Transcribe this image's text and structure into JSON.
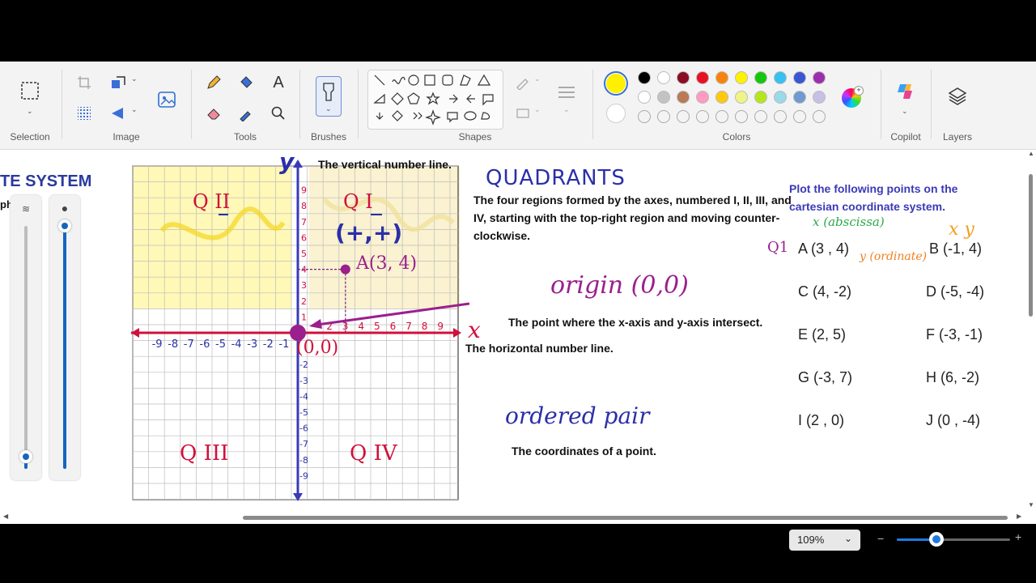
{
  "ribbon": {
    "groups": {
      "selection": "Selection",
      "image": "Image",
      "tools": "Tools",
      "brushes": "Brushes",
      "shapes": "Shapes",
      "colors": "Colors",
      "copilot": "Copilot",
      "layers": "Layers"
    },
    "tools_text_icon": "A",
    "colors": {
      "primary": "#ffef00",
      "secondary": "#ffffff",
      "palette_row1": [
        "#000000",
        "#ffffff",
        "#8b0d24",
        "#e81123",
        "#f7830d",
        "#fff100",
        "#16c60c",
        "#35c1f1",
        "#3a56d4",
        "#9c2fae"
      ],
      "palette_row2": [
        "#ffffff",
        "#c3c3c3",
        "#b97a57",
        "#ff9ac1",
        "#ffc90e",
        "#eff486",
        "#b5e61d",
        "#99d9ea",
        "#709ad1",
        "#c8bfe7"
      ]
    }
  },
  "left_panel": {
    "title_fragment": "TE SYSTEM",
    "label_fragment": "ph",
    "slider1_value_pct": 5,
    "slider2_value_pct": 100
  },
  "canvas": {
    "axis_y_label": "y",
    "axis_x_label": "x",
    "vertical_note": "The vertical number line.",
    "quadrant_labels": {
      "q1": "Q I",
      "q2": "Q II",
      "q3": "Q III",
      "q4": "Q IV"
    },
    "q1_sign": "(+,+)",
    "point_a": "A(3, 4)",
    "origin_label_graph": "(0,0)",
    "quadrants_heading": "QUADRANTS",
    "quadrants_def": [
      "The four regions formed by the axes, numbered I, II, III, and",
      "IV, starting with the top-right region and moving counter-",
      "clockwise."
    ],
    "origin_heading": "origin (0,0)",
    "origin_def": "The point where the x-axis and y-axis intersect.",
    "horizontal_note": "The horizontal number line.",
    "ordered_pair_heading": "ordered pair",
    "ordered_pair_def": "The coordinates of a point.",
    "x_ticks_neg": [
      "-9",
      "-8",
      "-7",
      "-6",
      "-5",
      "-4",
      "-3",
      "-2",
      "-1"
    ],
    "x_ticks_pos": [
      "2",
      "3",
      "4",
      "5",
      "6",
      "7",
      "8",
      "9"
    ],
    "y_ticks_pos": [
      "9",
      "8",
      "7",
      "6",
      "5",
      "4",
      "3",
      "2",
      "1"
    ],
    "y_ticks_neg": [
      "-2",
      "-3",
      "-4",
      "-5",
      "-6",
      "-7",
      "-8",
      "-9"
    ],
    "exercise": {
      "instruction": [
        "Plot the following points on the",
        "cartesian coordinate system."
      ],
      "abscissa_note": "x (abscissa)",
      "ordinate_note": "y (ordinate)",
      "xy_note": "x  y",
      "q1": "Q1",
      "points": [
        {
          "left": "A (3 , 4)",
          "right": "B (-1, 4)"
        },
        {
          "left": "C (4, -2)",
          "right": "D (-5, -4)"
        },
        {
          "left": "E (2, 5)",
          "right": "F (-3, -1)"
        },
        {
          "left": "G (-3, 7)",
          "right": "H (6, -2)"
        },
        {
          "left": "I (2 , 0)",
          "right": "J (0 , -4)"
        }
      ]
    }
  },
  "status": {
    "zoom": "109%",
    "zoom_slider_pct": 35
  }
}
